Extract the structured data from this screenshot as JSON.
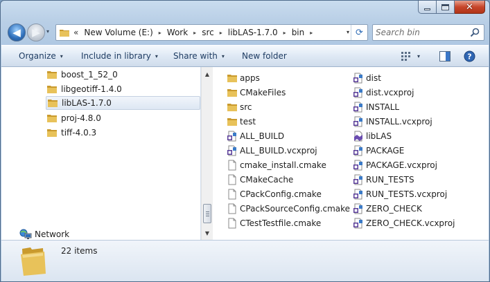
{
  "window": {
    "caption_buttons": {
      "minimize": "minimize-icon",
      "maximize": "maximize-icon",
      "close": "✕"
    }
  },
  "nav": {
    "back": "◀",
    "forward": "▶",
    "recent": "▾",
    "breadcrumb_lead": "«",
    "breadcrumb": [
      "New Volume (E:)",
      "Work",
      "src",
      "libLAS-1.7.0",
      "bin"
    ],
    "crumb_arrow": "▸",
    "address_dropdown": "▾",
    "refresh": "⟳",
    "search_placeholder": "Search bin"
  },
  "toolbar": {
    "organize": "Organize",
    "include": "Include in library",
    "share": "Share with",
    "new_folder": "New folder",
    "dropdown": "▾"
  },
  "tree": {
    "items": [
      {
        "label": "boost_1_52_0",
        "selected": false
      },
      {
        "label": "libgeotiff-1.4.0",
        "selected": false
      },
      {
        "label": "libLAS-1.7.0",
        "selected": true
      },
      {
        "label": "proj-4.8.0",
        "selected": false
      },
      {
        "label": "tiff-4.0.3",
        "selected": false
      }
    ],
    "network": "Network"
  },
  "scrollbar": {
    "up": "▲",
    "down": "▼"
  },
  "files": {
    "left": [
      {
        "name": "apps",
        "icon": "folder"
      },
      {
        "name": "CMakeFiles",
        "icon": "folder"
      },
      {
        "name": "src",
        "icon": "folder"
      },
      {
        "name": "test",
        "icon": "folder"
      },
      {
        "name": "ALL_BUILD",
        "icon": "vcproj"
      },
      {
        "name": "ALL_BUILD.vcxproj",
        "icon": "vcproj"
      },
      {
        "name": "cmake_install.cmake",
        "icon": "file"
      },
      {
        "name": "CMakeCache",
        "icon": "file"
      },
      {
        "name": "CPackConfig.cmake",
        "icon": "file"
      },
      {
        "name": "CPackSourceConfig.cmake",
        "icon": "file"
      },
      {
        "name": "CTestTestfile.cmake",
        "icon": "file"
      }
    ],
    "right": [
      {
        "name": "dist",
        "icon": "vcproj"
      },
      {
        "name": "dist.vcxproj",
        "icon": "vcproj"
      },
      {
        "name": "INSTALL",
        "icon": "vcproj"
      },
      {
        "name": "INSTALL.vcxproj",
        "icon": "vcproj"
      },
      {
        "name": "libLAS",
        "icon": "solution"
      },
      {
        "name": "PACKAGE",
        "icon": "vcproj"
      },
      {
        "name": "PACKAGE.vcxproj",
        "icon": "vcproj"
      },
      {
        "name": "RUN_TESTS",
        "icon": "vcproj"
      },
      {
        "name": "RUN_TESTS.vcxproj",
        "icon": "vcproj"
      },
      {
        "name": "ZERO_CHECK",
        "icon": "vcproj"
      },
      {
        "name": "ZERO_CHECK.vcxproj",
        "icon": "vcproj"
      }
    ]
  },
  "status": {
    "item_count": "22 items"
  },
  "colors": {
    "folder": "#e8c25a",
    "folder_dark": "#c99a2e",
    "accent": "#2d6bb5"
  }
}
